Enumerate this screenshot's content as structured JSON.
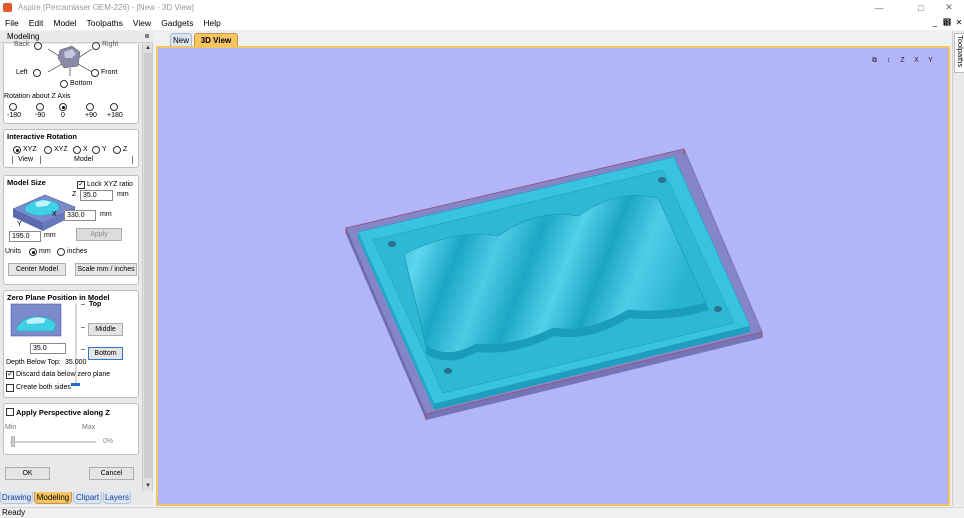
{
  "window": {
    "title": "Aspire (Percamlaser OEM-226) - [New - 3D View]",
    "controls": {
      "minimize": "—",
      "maximize": "□",
      "close": "✕"
    }
  },
  "menu": {
    "items": [
      "File",
      "Edit",
      "Model",
      "Toolpaths",
      "View",
      "Gadgets",
      "Help"
    ],
    "mdi": {
      "minimize": "_",
      "restore": "๾",
      "close": "✕"
    }
  },
  "panel": {
    "title": "Modeling",
    "pin": "⩎",
    "orientation": {
      "back": "Back",
      "right": "Right",
      "left": "Left",
      "front": "Front",
      "bottom": "Bottom",
      "rotation_label": "Rotation about Z Axis",
      "rotations": [
        "-180",
        "-90",
        "0",
        "+90",
        "+180"
      ],
      "selected_rotation": "0"
    },
    "interactive_rotation": {
      "title": "Interactive Rotation",
      "options": [
        "XYZ",
        "XYZ",
        "X",
        "Y",
        "Z"
      ],
      "view_label": "View",
      "model_label": "Model"
    },
    "model_size": {
      "title": "Model Size",
      "lock_label": "Lock XYZ ratio",
      "z_label": "Z",
      "x_label": "X",
      "y_label": "Y",
      "z_value": "35.0",
      "x_value": "330.0",
      "y_value": "195.0",
      "unit": "mm",
      "apply_label": "Apply",
      "units_label": "Units",
      "unit_mm": "mm",
      "unit_inches": "inches",
      "center_label": "Center Model",
      "scale_label": "Scale mm / inches"
    },
    "zero_plane": {
      "title": "Zero Plane Position in Model",
      "top_label": "Top",
      "middle_label": "Middle",
      "bottom_label": "Bottom",
      "value": "35.0",
      "depth_label": "Depth Below Top:",
      "depth_value": "35.000",
      "discard_label": "Discard data below zero plane",
      "both_sides_label": "Create both sides"
    },
    "perspective": {
      "title": "Apply Perspective along Z",
      "min_label": "Min",
      "max_label": "Max",
      "value": "0%"
    },
    "ok_label": "OK",
    "cancel_label": "Cancel"
  },
  "bottom_tabs": [
    "Drawing",
    "Modeling",
    "Clipart",
    "Layers"
  ],
  "doc_tabs": [
    "New",
    "3D View"
  ],
  "view_toolbar": [
    "⧉",
    "↕",
    "Z",
    "X",
    "Y"
  ],
  "right_panel": {
    "tab": "Toolpaths"
  },
  "status": {
    "text": "Ready"
  },
  "colors": {
    "viewport_bg": "#b3b5fb",
    "model_cyan": "#36c3df",
    "frame_purple": "#8182c4",
    "active_tab": "#f6c562"
  }
}
